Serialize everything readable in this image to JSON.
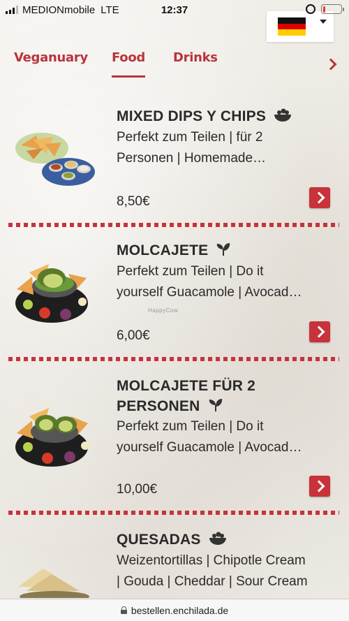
{
  "status_bar": {
    "carrier": "MEDIONmobile",
    "network": "LTE",
    "time": "12:37",
    "battery_level": 0.15
  },
  "language": {
    "flag": "german-flag-icon"
  },
  "tabs": [
    {
      "label": "Veganuary",
      "active": false
    },
    {
      "label": "Food",
      "active": true
    },
    {
      "label": "Drinks",
      "active": false
    }
  ],
  "menu_items": [
    {
      "title": "MIXED DIPS Y CHIPS",
      "title_icon": "bowl-icon",
      "description_line1": "Perfekt zum Teilen | für 2",
      "description_line2": "Personen | Homemade…",
      "price": "8,50€"
    },
    {
      "title": "MOLCAJETE",
      "title_icon": "vegan-sprout-icon",
      "description_line1": "Perfekt zum Teilen | Do it",
      "description_line2": "yourself Guacamole | Avocad…",
      "price": "6,00€"
    },
    {
      "title_line1": "MOLCAJETE FÜR 2",
      "title_line2": "PERSONEN",
      "title_icon": "vegan-sprout-icon",
      "description_line1": "Perfekt zum Teilen | Do it",
      "description_line2": "yourself Guacamole | Avocad…",
      "price": "10,00€"
    },
    {
      "title": "QUESADAS",
      "title_icon": "bowl-icon",
      "description_line1": "Weizentortillas | Chipotle Cream",
      "description_line2": "| Gouda | Cheddar | Sour Cream"
    }
  ],
  "watermark": "HappyCow",
  "url_bar": {
    "url": "bestellen.enchilada.de"
  },
  "colors": {
    "accent": "#c8323a",
    "tab_text": "#b8343c",
    "background": "#efece6"
  }
}
